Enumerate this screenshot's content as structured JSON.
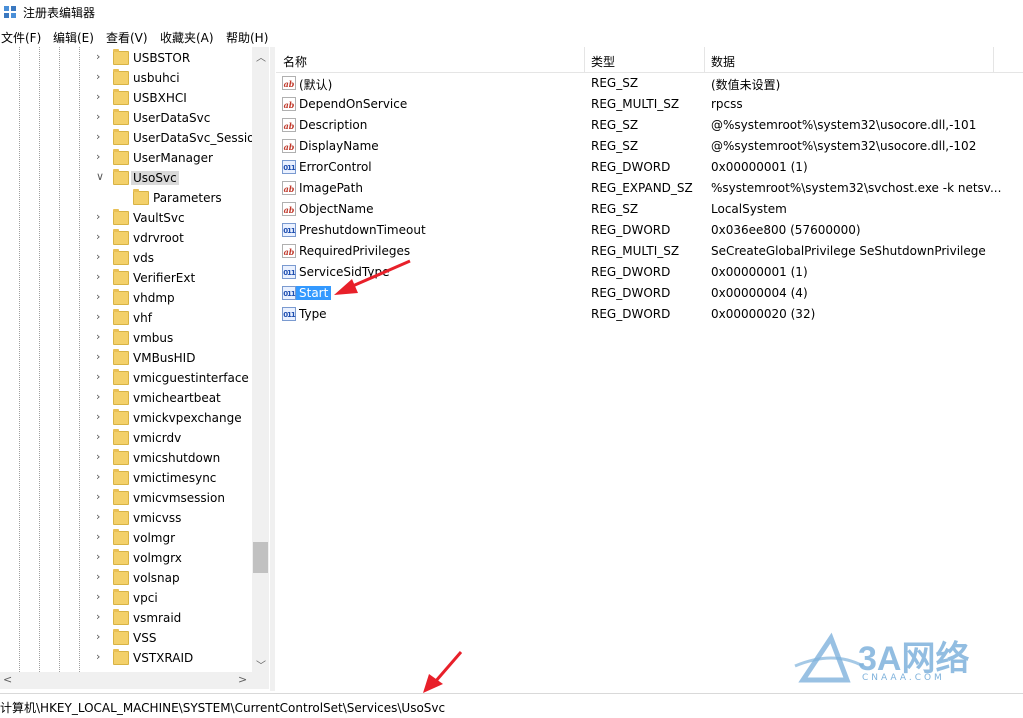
{
  "window": {
    "title": "注册表编辑器"
  },
  "menu": [
    "文件(F)",
    "编辑(E)",
    "查看(V)",
    "收藏夹(A)",
    "帮助(H)"
  ],
  "tree": {
    "items": [
      "USBSTOR",
      "usbuhci",
      "USBXHCI",
      "UserDataSvc",
      "UserDataSvc_Session",
      "UserManager",
      "UsoSvc",
      "Parameters",
      "VaultSvc",
      "vdrvroot",
      "vds",
      "VerifierExt",
      "vhdmp",
      "vhf",
      "vmbus",
      "VMBusHID",
      "vmicguestinterface",
      "vmicheartbeat",
      "vmickvpexchange",
      "vmicrdv",
      "vmicshutdown",
      "vmictimesync",
      "vmicvmsession",
      "vmicvss",
      "volmgr",
      "volmgrx",
      "volsnap",
      "vpci",
      "vsmraid",
      "VSS",
      "VSTXRAID"
    ],
    "selected": "UsoSvc",
    "expanded": "UsoSvc"
  },
  "list": {
    "headers": {
      "name": "名称",
      "type": "类型",
      "data": "数据"
    },
    "rows": [
      {
        "icon": "string-value-icon",
        "name": "(默认)",
        "type": "REG_SZ",
        "data": "(数值未设置)"
      },
      {
        "icon": "string-value-icon",
        "name": "DependOnService",
        "type": "REG_MULTI_SZ",
        "data": "rpcss"
      },
      {
        "icon": "string-value-icon",
        "name": "Description",
        "type": "REG_SZ",
        "data": "@%systemroot%\\system32\\usocore.dll,-101"
      },
      {
        "icon": "string-value-icon",
        "name": "DisplayName",
        "type": "REG_SZ",
        "data": "@%systemroot%\\system32\\usocore.dll,-102"
      },
      {
        "icon": "binary-value-icon",
        "name": "ErrorControl",
        "type": "REG_DWORD",
        "data": "0x00000001 (1)"
      },
      {
        "icon": "string-value-icon",
        "name": "ImagePath",
        "type": "REG_EXPAND_SZ",
        "data": "%systemroot%\\system32\\svchost.exe -k netsv..."
      },
      {
        "icon": "string-value-icon",
        "name": "ObjectName",
        "type": "REG_SZ",
        "data": "LocalSystem"
      },
      {
        "icon": "binary-value-icon",
        "name": "PreshutdownTimeout",
        "type": "REG_DWORD",
        "data": "0x036ee800 (57600000)"
      },
      {
        "icon": "string-value-icon",
        "name": "RequiredPrivileges",
        "type": "REG_MULTI_SZ",
        "data": "SeCreateGlobalPrivilege SeShutdownPrivilege"
      },
      {
        "icon": "binary-value-icon",
        "name": "ServiceSidType",
        "type": "REG_DWORD",
        "data": "0x00000001 (1)"
      },
      {
        "icon": "binary-value-icon",
        "name": "Start",
        "type": "REG_DWORD",
        "data": "0x00000004 (4)"
      },
      {
        "icon": "binary-value-icon",
        "name": "Type",
        "type": "REG_DWORD",
        "data": "0x00000020 (32)"
      }
    ],
    "selected": "Start"
  },
  "status": {
    "path": "计算机\\HKEY_LOCAL_MACHINE\\SYSTEM\\CurrentControlSet\\Services\\UsoSvc"
  },
  "watermark": {
    "brand": "3A网络",
    "domain": "CNAAA.COM"
  },
  "colors": {
    "selection": "#3399ff",
    "arrow": "#e8202a",
    "watermark": "#7fb2dc"
  }
}
